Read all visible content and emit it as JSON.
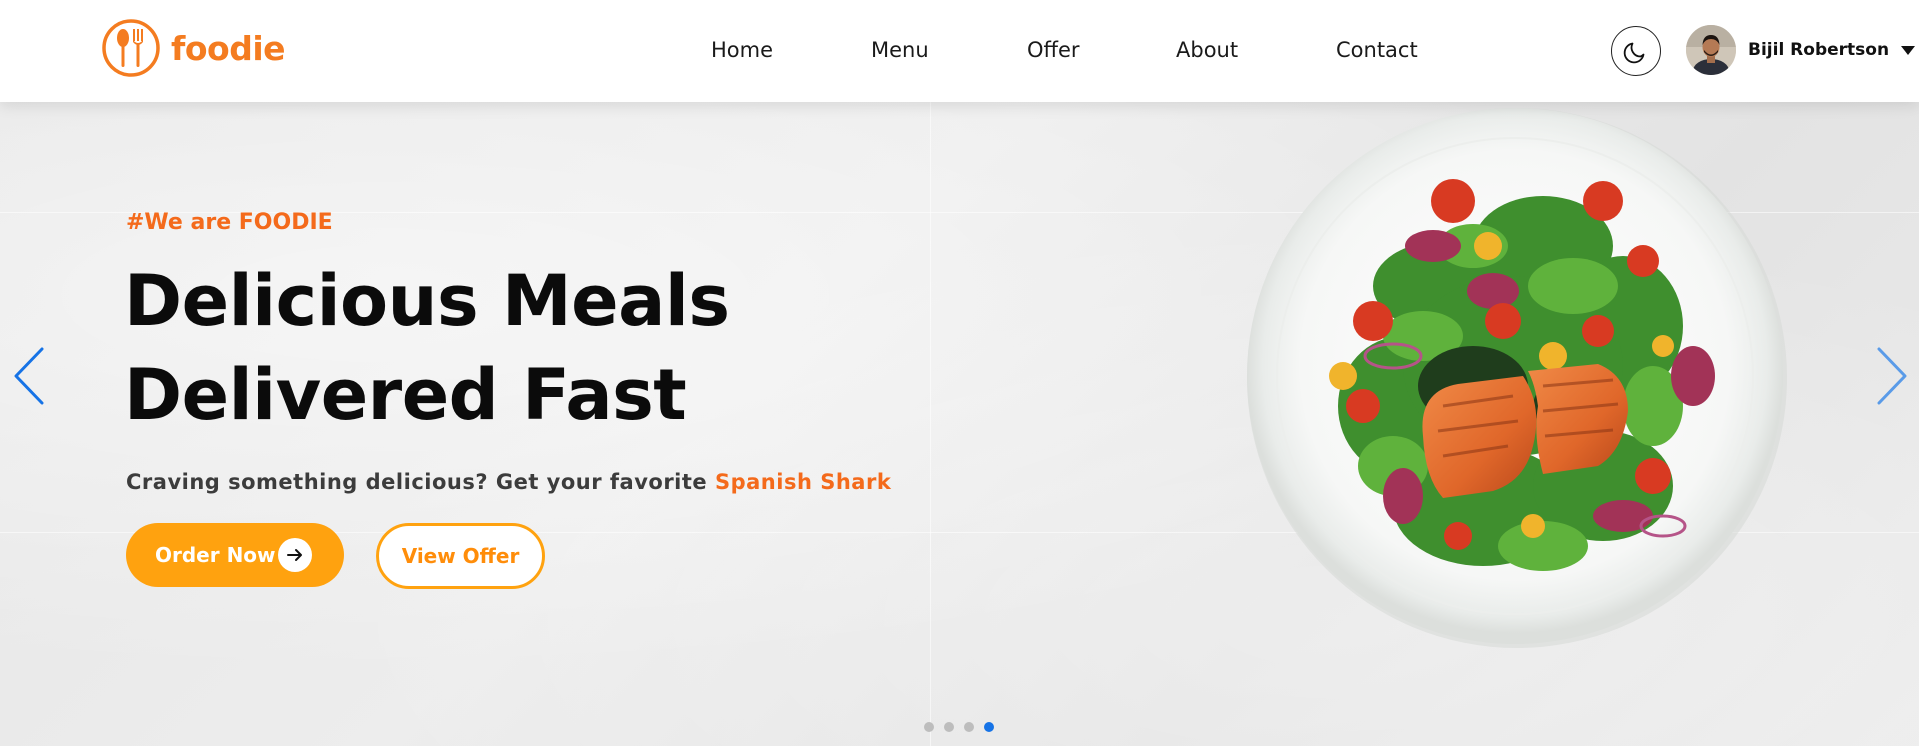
{
  "brand": {
    "name": "foodie",
    "accent_color": "#f47c20",
    "logo_icon": "fork-spoon-icon"
  },
  "nav": {
    "items": [
      {
        "label": "Home"
      },
      {
        "label": "Menu"
      },
      {
        "label": "Offer"
      },
      {
        "label": "About"
      },
      {
        "label": "Contact"
      }
    ]
  },
  "header": {
    "theme_toggle_icon": "moon-icon",
    "user": {
      "name": "Bijil Robertson",
      "avatar_icon": "avatar",
      "dropdown_icon": "caret-down-icon"
    }
  },
  "hero": {
    "eyebrow": "#We are FOODIE",
    "headline_line1": "Delicious Meals",
    "headline_line2": "Delivered Fast",
    "tagline_prefix": "Craving something delicious? Get your favorite",
    "tagline_highlight": "Spanish Shark",
    "primary_button": {
      "label": "Order Now",
      "icon": "arrow-right-icon",
      "color": "#ffa20f"
    },
    "secondary_button": {
      "label": "View Offer",
      "color": "#ff8d0a"
    },
    "highlight_color": "#f46a1b",
    "image": "salmon-salad-plate"
  },
  "carousel": {
    "prev_icon": "chevron-left-icon",
    "next_icon": "chevron-right-icon",
    "slide_count": 4,
    "active_slide": 4,
    "active_color": "#1673e6"
  }
}
